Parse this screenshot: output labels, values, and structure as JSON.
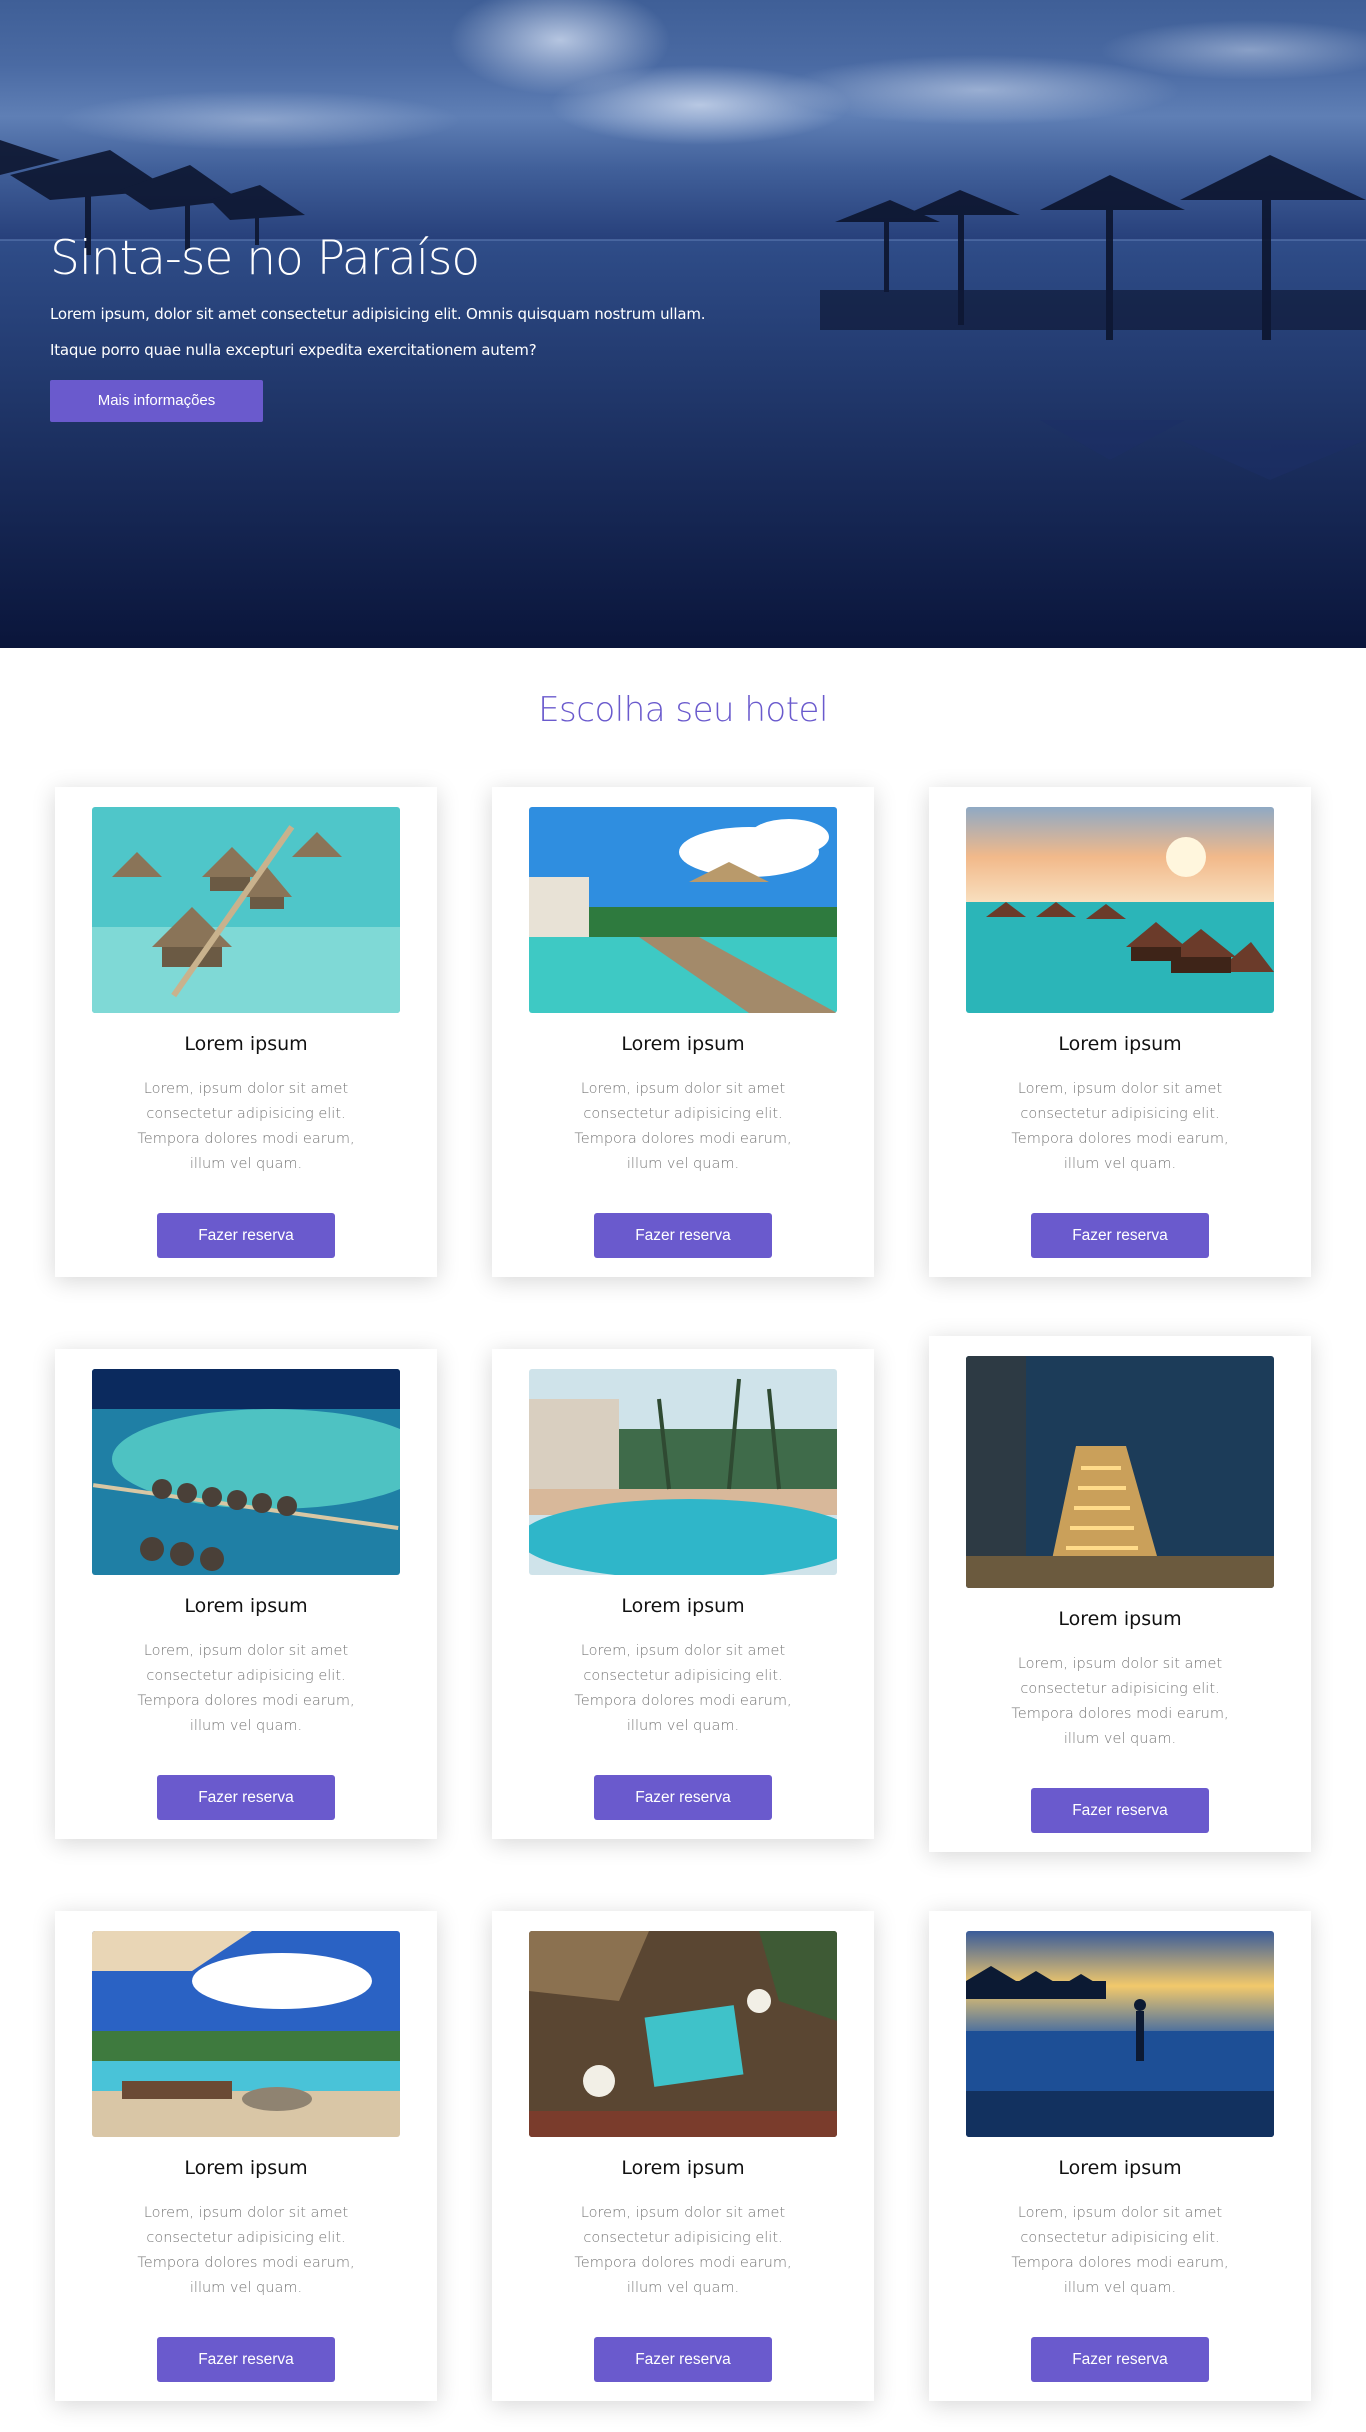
{
  "hero": {
    "title": "Sinta-se no Paraíso",
    "text_line1": "Lorem ipsum, dolor sit amet consectetur adipisicing elit. Omnis quisquam nostrum ullam.",
    "text_line2": "Itaque porro quae nulla excepturi expedita exercitationem autem?",
    "button_label": "Mais informações"
  },
  "section": {
    "title": "Escolha seu hotel"
  },
  "colors": {
    "accent": "#6a5acd"
  },
  "hotels": [
    {
      "name": "Lorem ipsum",
      "description": "Lorem, ipsum dolor sit amet consectetur adipisicing elit. Tempora dolores modi earum, illum vel quam.",
      "button_label": "Fazer reserva"
    },
    {
      "name": "Lorem ipsum",
      "description": "Lorem, ipsum dolor sit amet consectetur adipisicing elit. Tempora dolores modi earum, illum vel quam.",
      "button_label": "Fazer reserva"
    },
    {
      "name": "Lorem ipsum",
      "description": "Lorem, ipsum dolor sit amet consectetur adipisicing elit. Tempora dolores modi earum, illum vel quam.",
      "button_label": "Fazer reserva"
    },
    {
      "name": "Lorem ipsum",
      "description": "Lorem, ipsum dolor sit amet consectetur adipisicing elit. Tempora dolores modi earum, illum vel quam.",
      "button_label": "Fazer reserva"
    },
    {
      "name": "Lorem ipsum",
      "description": "Lorem, ipsum dolor sit amet consectetur adipisicing elit. Tempora dolores modi earum, illum vel quam.",
      "button_label": "Fazer reserva"
    },
    {
      "name": "Lorem ipsum",
      "description": "Lorem, ipsum dolor sit amet consectetur adipisicing elit. Tempora dolores modi earum, illum vel quam.",
      "button_label": "Fazer reserva"
    },
    {
      "name": "Lorem ipsum",
      "description": "Lorem, ipsum dolor sit amet consectetur adipisicing elit. Tempora dolores modi earum, illum vel quam.",
      "button_label": "Fazer reserva"
    },
    {
      "name": "Lorem ipsum",
      "description": "Lorem, ipsum dolor sit amet consectetur adipisicing elit. Tempora dolores modi earum, illum vel quam.",
      "button_label": "Fazer reserva"
    },
    {
      "name": "Lorem ipsum",
      "description": "Lorem, ipsum dolor sit amet consectetur adipisicing elit. Tempora dolores modi earum, illum vel quam.",
      "button_label": "Fazer reserva"
    }
  ]
}
